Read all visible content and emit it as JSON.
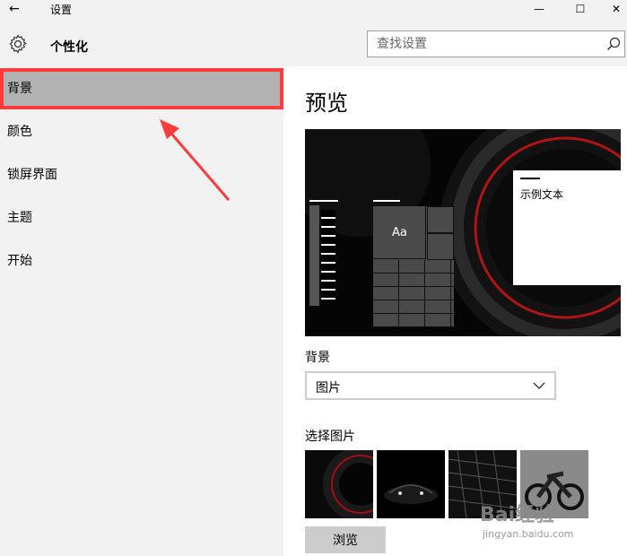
{
  "window": {
    "title": "设置",
    "minimize": "—",
    "maximize": "☐",
    "close": "✕"
  },
  "header": {
    "page_title": "个性化"
  },
  "search": {
    "placeholder": "查找设置"
  },
  "sidebar": {
    "items": [
      {
        "label": "背景",
        "selected": true
      },
      {
        "label": "颜色"
      },
      {
        "label": "锁屏界面"
      },
      {
        "label": "主题"
      },
      {
        "label": "开始"
      }
    ]
  },
  "main": {
    "preview_heading": "预览",
    "preview_tile_label": "Aa",
    "preview_sample_text": "示例文本",
    "background_label": "背景",
    "background_value": "图片",
    "choose_picture_label": "选择图片",
    "browse_label": "浏览"
  },
  "watermark": {
    "text": "Bai经验",
    "url": "jingyan.baidu.com"
  },
  "colors": {
    "accent_red": "#ff3b3b",
    "sidebar_bg": "#f2f2f2",
    "selected_bg": "#b2b2b2"
  }
}
